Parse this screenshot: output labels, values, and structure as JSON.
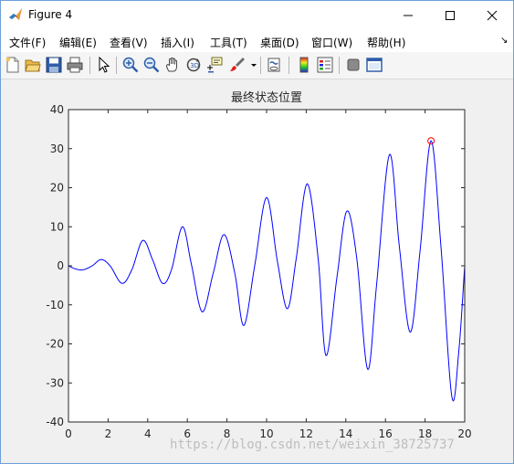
{
  "window": {
    "title": "Figure 4",
    "minimize_icon": "minimize-icon",
    "maximize_icon": "maximize-icon",
    "close_icon": "close-icon"
  },
  "menu": {
    "items": [
      {
        "label": "文件(F)"
      },
      {
        "label": "编辑(E)"
      },
      {
        "label": "查看(V)"
      },
      {
        "label": "插入(I)"
      },
      {
        "label": "工具(T)"
      },
      {
        "label": "桌面(D)"
      },
      {
        "label": "窗口(W)"
      },
      {
        "label": "帮助(H)"
      }
    ],
    "overflow_glyph": "↘"
  },
  "toolbar": {
    "icons": [
      "new-figure-icon",
      "open-file-icon",
      "save-icon",
      "print-icon",
      "edit-plot-icon",
      "zoom-in-icon",
      "zoom-out-icon",
      "pan-icon",
      "rotate-3d-icon",
      "data-cursor-icon",
      "brush-icon",
      "link-plot-icon",
      "colorbar-icon",
      "legend-icon",
      "hide-plot-tools-icon",
      "show-plot-tools-icon"
    ]
  },
  "watermark": "https://blog.csdn.net/weixin_38725737",
  "chart_data": {
    "type": "line",
    "title": "最终状态位置",
    "xlabel": "",
    "ylabel": "",
    "xlim": [
      0,
      20
    ],
    "ylim": [
      -40,
      40
    ],
    "xticks": [
      "0",
      "2",
      "4",
      "6",
      "8",
      "10",
      "12",
      "14",
      "16",
      "18",
      "20"
    ],
    "yticks": [
      "-40",
      "-30",
      "-20",
      "-10",
      "0",
      "10",
      "20",
      "30",
      "40"
    ],
    "series": [
      {
        "color": "#0000ff",
        "x": [
          0,
          0.35,
          0.75,
          1.2,
          1.65,
          2.1,
          2.7,
          3.2,
          3.75,
          4.25,
          4.75,
          5.2,
          5.75,
          6.2,
          6.75,
          7.3,
          7.85,
          8.4,
          8.85,
          9.4,
          10.0,
          10.55,
          11.05,
          11.5,
          12.05,
          12.6,
          13.0,
          13.55,
          14.05,
          14.55,
          15.1,
          15.55,
          16.2,
          16.7,
          17.25,
          17.75,
          18.3,
          18.8,
          19.35,
          19.7,
          20.0
        ],
        "y": [
          0,
          -0.8,
          -1.0,
          0.0,
          1.6,
          0.0,
          -4.5,
          -1.0,
          6.5,
          1.5,
          -4.5,
          -1.0,
          10.0,
          0.5,
          -11.8,
          -2.0,
          8.0,
          -2.0,
          -15.3,
          0.0,
          17.5,
          1.0,
          -11.0,
          2.0,
          21.0,
          2.0,
          -23.0,
          -3.0,
          14.0,
          2.0,
          -26.5,
          -5.0,
          28.5,
          5.0,
          -17.0,
          4.0,
          32.0,
          5.0,
          -33.5,
          -22.0,
          0.0
        ]
      }
    ],
    "marker": {
      "x": 18.3,
      "y": 32.0,
      "shape": "circle",
      "color": "#ff0000"
    },
    "grid": false
  }
}
